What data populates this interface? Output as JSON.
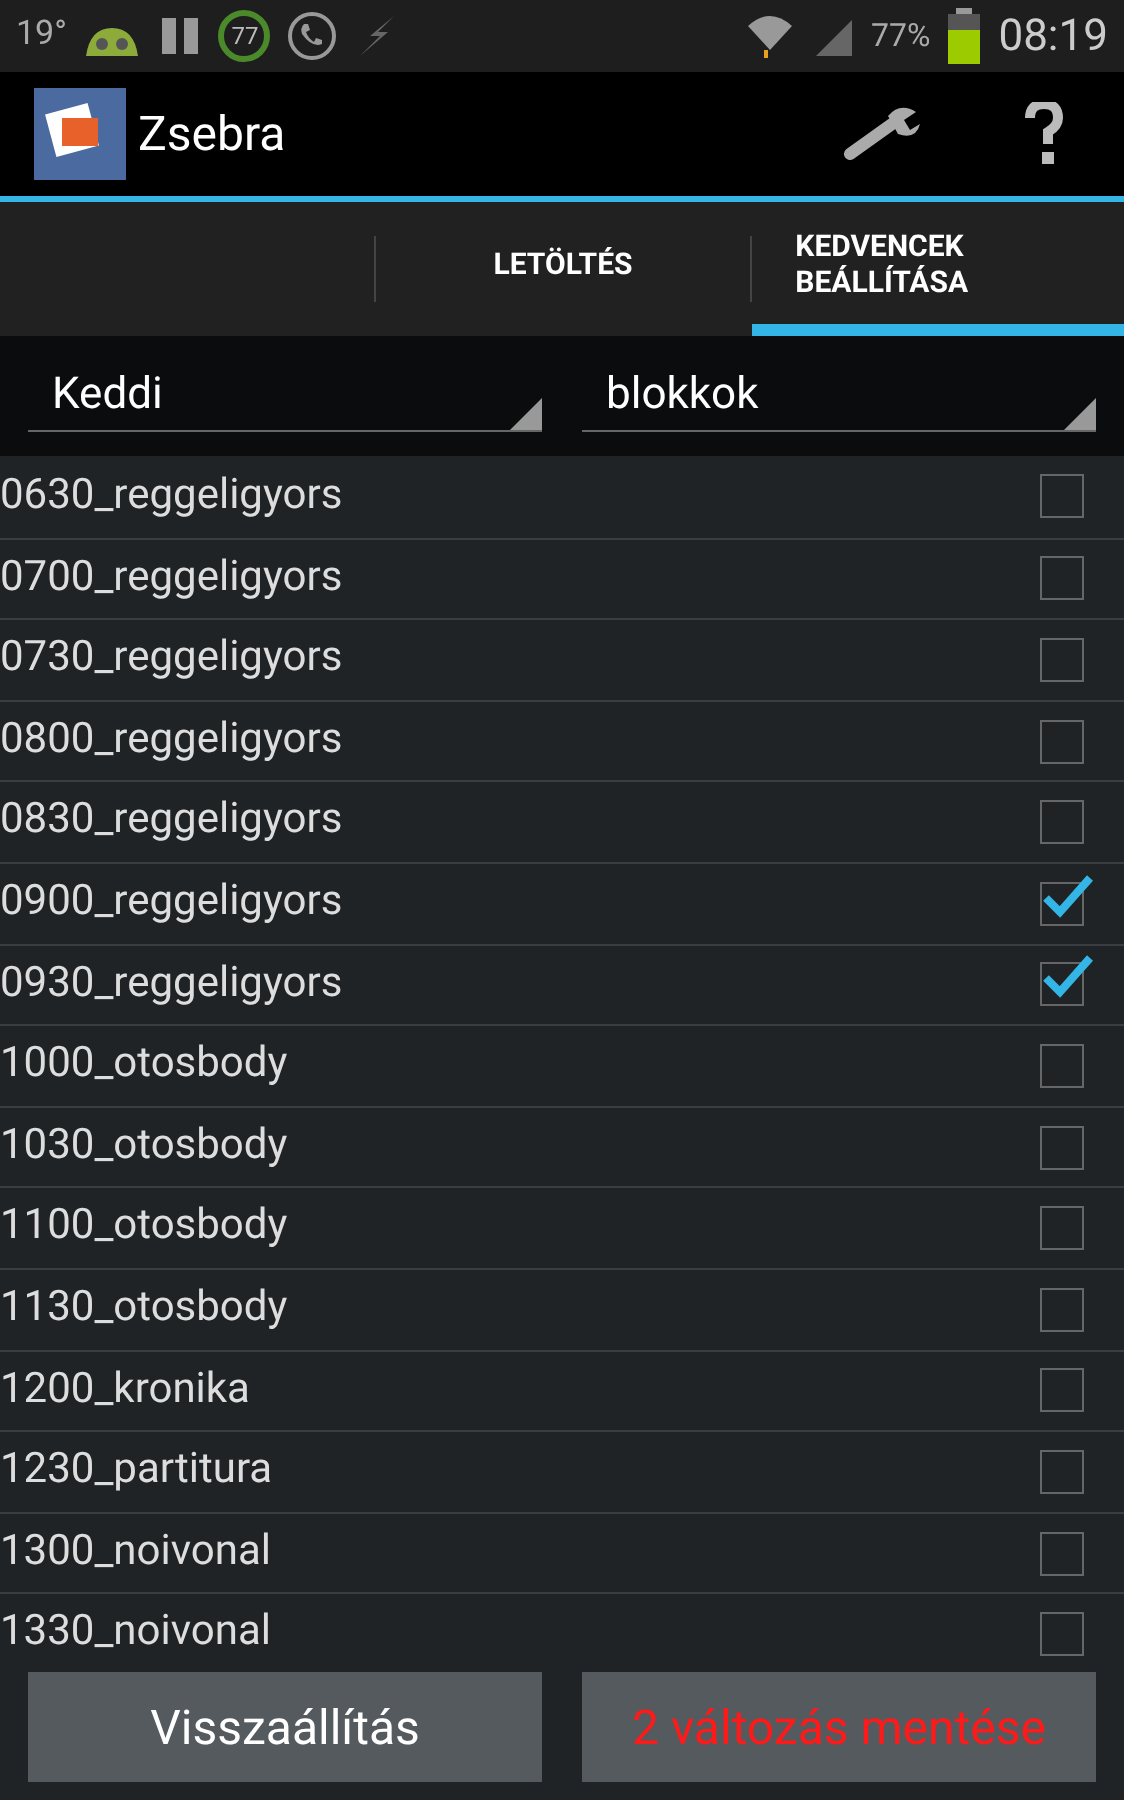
{
  "status_bar": {
    "temperature": "19°",
    "badge": "77",
    "battery": "77%",
    "time": "08:19"
  },
  "action_bar": {
    "title": "Zsebra"
  },
  "tabs": [
    {
      "label": "LETÖLTÉS",
      "selected": false
    },
    {
      "label": "KEDVENCEK BEÁLLÍTÁSA",
      "selected": true
    }
  ],
  "spinners": [
    {
      "value": "Keddi"
    },
    {
      "value": "blokkok"
    }
  ],
  "items": [
    {
      "label": "0630_reggeligyors",
      "checked": false
    },
    {
      "label": "0700_reggeligyors",
      "checked": false
    },
    {
      "label": "0730_reggeligyors",
      "checked": false
    },
    {
      "label": "0800_reggeligyors",
      "checked": false
    },
    {
      "label": "0830_reggeligyors",
      "checked": false
    },
    {
      "label": "0900_reggeligyors",
      "checked": true
    },
    {
      "label": "0930_reggeligyors",
      "checked": true
    },
    {
      "label": "1000_otosbody",
      "checked": false
    },
    {
      "label": "1030_otosbody",
      "checked": false
    },
    {
      "label": "1100_otosbody",
      "checked": false
    },
    {
      "label": "1130_otosbody",
      "checked": false
    },
    {
      "label": "1200_kronika",
      "checked": false
    },
    {
      "label": "1230_partitura",
      "checked": false
    },
    {
      "label": "1300_noivonal",
      "checked": false
    },
    {
      "label": "1330_noivonal",
      "checked": false
    }
  ],
  "buttons": [
    {
      "label": "Visszaállítás",
      "kind": "normal"
    },
    {
      "label": "2 változás mentése",
      "kind": "highlight"
    }
  ]
}
